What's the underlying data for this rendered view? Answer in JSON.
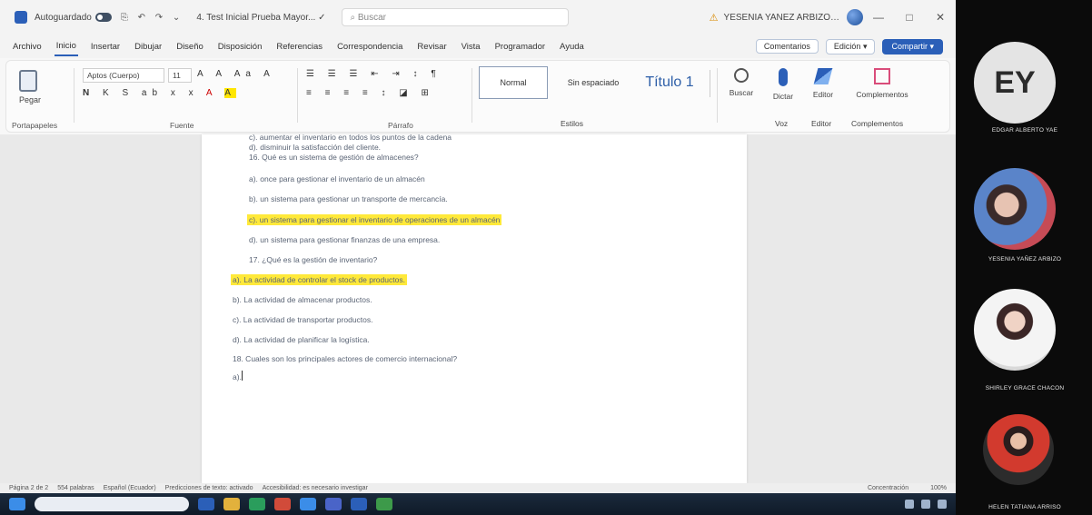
{
  "titlebar": {
    "autosave": "Autoguardado",
    "qa_icons": "⎘ ↶ ↷ ⌄",
    "doc_title": "4. Test Inicial Prueba Mayor... ✓",
    "search_placeholder": "Buscar",
    "user_name": "YESENIA YANEZ ARBIZO…",
    "minimize": "—",
    "maximize": "□",
    "close": "✕"
  },
  "tabs": {
    "items": [
      "Archivo",
      "Inicio",
      "Insertar",
      "Dibujar",
      "Diseño",
      "Disposición",
      "Referencias",
      "Correspondencia",
      "Revisar",
      "Vista",
      "Programador",
      "Ayuda"
    ],
    "comments": "Comentarios",
    "editing": "Edición ▾",
    "share": "Compartir ▾"
  },
  "ribbon": {
    "paste": "Pegar",
    "clipboard": "Portapapeles",
    "font_name": "Aptos (Cuerpo)",
    "font_size": "11",
    "font_top_icons": "A A Aa A",
    "font_fmt": {
      "b": "N",
      "rest": "K S ab x x",
      "color": "A",
      "hl": "A"
    },
    "font_label": "Fuente",
    "para_top": "☰ ☰ ☰ ⇤ ⇥ ↕ ¶",
    "para_bottom": "≡ ≡ ≡ ≡ ↕ ◪ ⊞",
    "para_label": "Párrafo",
    "style_normal": "Normal",
    "style_nospace": "Sin espaciado",
    "style_t1": "Título 1",
    "styles_label": "Estilos",
    "dictate": "Dictar",
    "editor": "Editor",
    "addins": "Complementos",
    "find": "Buscar",
    "voice_label": "Voz",
    "editor_label": "Editor",
    "addins_label": "Complementos"
  },
  "doc": {
    "lines": [
      "c). aumentar el inventario en todos los puntos de la cadena",
      "d). disminuir la satisfacción del cliente.",
      "16. Qué es un sistema de gestión de almacenes?",
      "a). once para gestionar el inventario de un almacén",
      "b). un sistema para gestionar un transporte de mercancía.",
      "c). un sistema para gestionar el inventario de operaciones de un almacén",
      "d). un sistema para gestionar finanzas de una empresa.",
      "17. ¿Qué es la gestión de inventario?",
      "a). La actividad de controlar el stock de productos.",
      "b). La actividad de almacenar productos.",
      "c). La actividad de transportar productos.",
      "d). La actividad de planificar la logística.",
      "18. Cuales son los principales actores de comercio internacional?",
      "a)."
    ]
  },
  "statusbar": {
    "page": "Página 2 de 2",
    "words": "554 palabras",
    "lang": "Español (Ecuador)",
    "predict": "Predicciones de texto: activado",
    "access": "Accesibilidad: es necesario investigar",
    "focus": "Concentración",
    "zoom": "100%"
  },
  "participants": [
    {
      "initials": "EY",
      "name": "EDGAR ALBERTO YAE"
    },
    {
      "name": "YESENIA YAÑEZ ARBIZO"
    },
    {
      "name": "SHIRLEY GRACE CHACON"
    },
    {
      "name": "HELEN TATIANA ARRISO"
    }
  ]
}
